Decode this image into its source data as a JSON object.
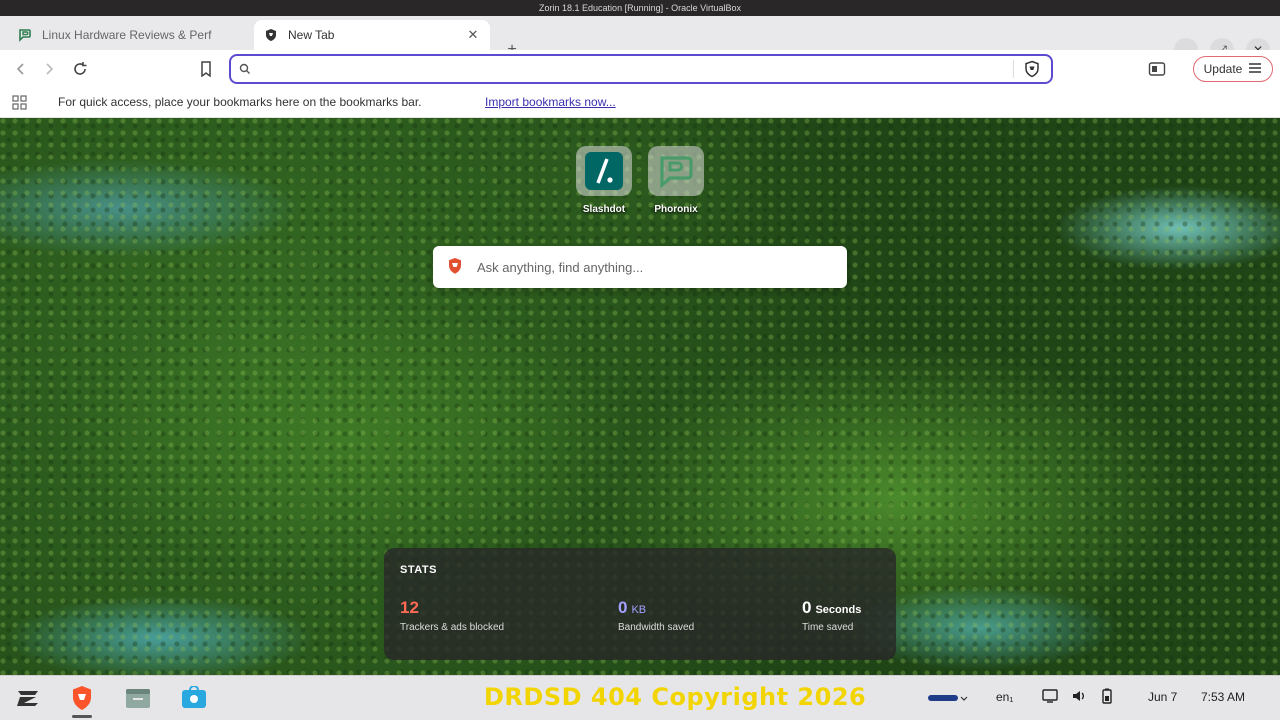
{
  "vm_window": {
    "title": "Zorin 18.1 Education [Running] - Oracle VirtualBox"
  },
  "tabs": [
    {
      "title": "Linux Hardware Reviews & Perf",
      "active": false,
      "icon": "phoronix-icon"
    },
    {
      "title": "New Tab",
      "active": true,
      "icon": "brave-shield-icon"
    }
  ],
  "toolbar": {
    "address_value": "",
    "update_label": "Update"
  },
  "bookmarks_bar": {
    "message": "For quick access, place your bookmarks here on the bookmarks bar.",
    "import_link": "Import bookmarks now..."
  },
  "ntp": {
    "top_sites": [
      {
        "label": "Slashdot",
        "icon": "slashdot-icon"
      },
      {
        "label": "Phoronix",
        "icon": "phoronix-icon"
      }
    ],
    "search_placeholder": "Ask anything, find anything...",
    "stats": {
      "header": "STATS",
      "trackers_value": "12",
      "trackers_label": "Trackers & ads blocked",
      "bandwidth_value": "0",
      "bandwidth_unit": "KB",
      "bandwidth_label": "Bandwidth saved",
      "time_value": "0",
      "time_unit": "Seconds",
      "time_label": "Time saved"
    },
    "colors": {
      "trackers": "#ff6a55",
      "bandwidth": "#a3a1ff"
    }
  },
  "taskbar": {
    "watermark": "DRDSD 404 Copyright 2026",
    "language": "en₁",
    "date": "Jun 7",
    "time": "7:53 AM"
  }
}
